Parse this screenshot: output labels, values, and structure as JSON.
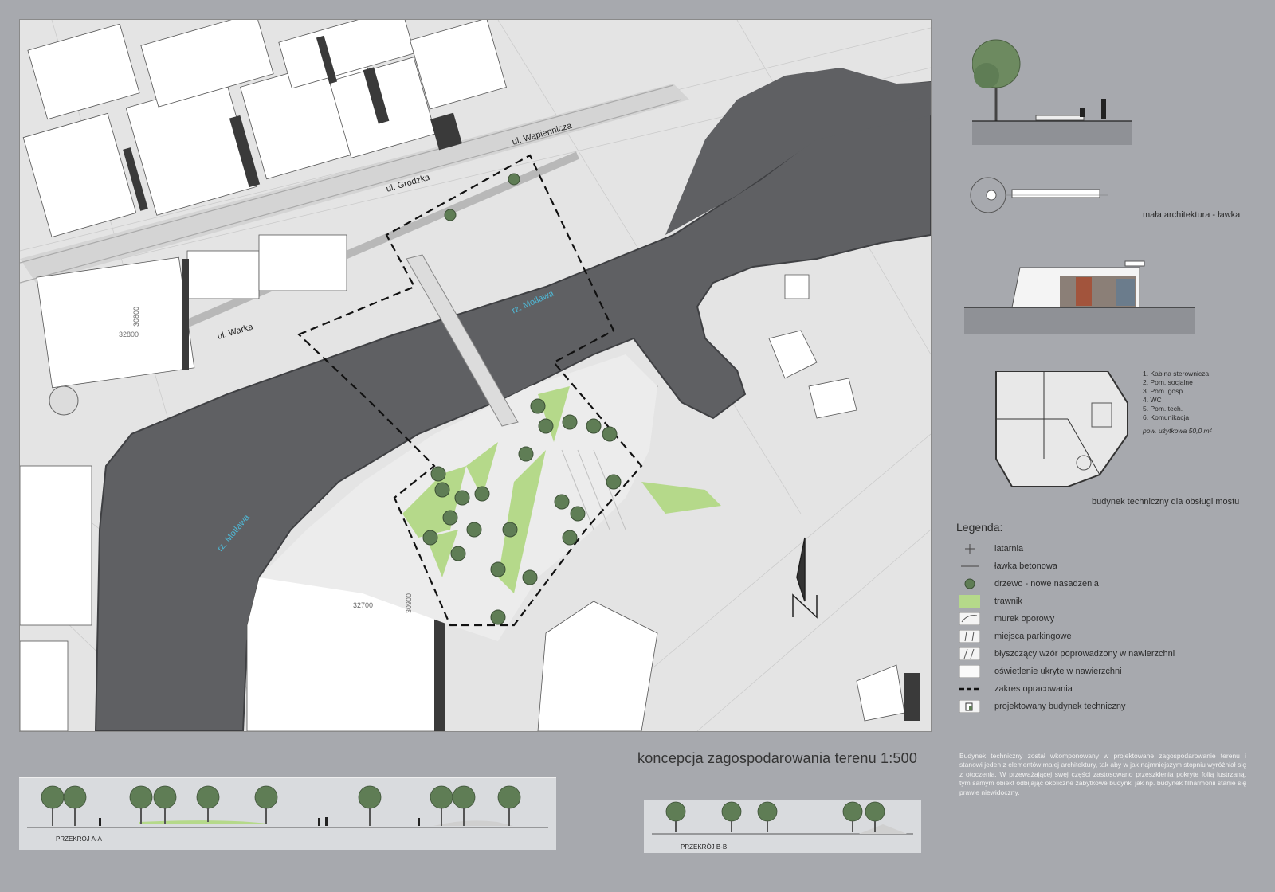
{
  "plan": {
    "title": "koncepcja zagospodarowania terenu 1:500",
    "streets": [
      "ul. Wapiennicza",
      "ul. Grodzka",
      "ul. Warka"
    ],
    "river_labels": [
      "rz. Motława",
      "rz. Motława"
    ],
    "parcel_numbers": [
      "30800",
      "32800",
      "32700",
      "30900"
    ]
  },
  "sections": {
    "aa_label": "PRZEKRÓJ A-A",
    "bb_label": "PRZEKRÓJ B-B"
  },
  "right_panel": {
    "bench_caption": "mała architektura - ławka",
    "building_caption": "budynek techniczny dla obsługi mostu",
    "rooms": [
      "1. Kabina sterownicza",
      "2. Pom. socjalne",
      "3. Pom. gosp.",
      "4. WC",
      "5. Pom. tech.",
      "6. Komunikacja"
    ],
    "area": "pow. użytkowa 50,0 m²"
  },
  "legend": {
    "title": "Legenda:",
    "items": [
      {
        "label": "latarnia",
        "icon": "lamp-icon"
      },
      {
        "label": "ławka betonowa",
        "icon": "bench-icon"
      },
      {
        "label": "drzewo - nowe nasadzenia",
        "icon": "tree-icon"
      },
      {
        "label": "trawnik",
        "icon": "lawn-swatch"
      },
      {
        "label": "murek oporowy",
        "icon": "retaining-wall-swatch"
      },
      {
        "label": "miejsca parkingowe",
        "icon": "parking-swatch"
      },
      {
        "label": "błyszczący wzór poprowadzony w nawierzchni",
        "icon": "shiny-pattern-swatch"
      },
      {
        "label": "oświetlenie ukryte w nawierzchni",
        "icon": "hidden-light-swatch"
      },
      {
        "label": "zakres opracowania",
        "icon": "dashed-line-icon"
      },
      {
        "label": "projektowany budynek techniczny",
        "icon": "building-icon"
      }
    ]
  },
  "description": "Budynek techniczny został wkomponowany w projektowane zagospodarowanie terenu i stanowi jeden z elementów małej architektury, tak aby w jak najmniejszym stopniu wyróżniał się z otoczenia. W przeważającej swej części zastosowano przeszklenia pokryte folią lustrzaną, tym samym obiekt odbijając okoliczne zabytkowe budynki jak np. budynek filharmonii stanie się prawie niewidoczny.",
  "colors": {
    "background": "#a7a9ae",
    "water": "#5f6063",
    "lawn": "#b5d98a",
    "tree": "#5f7d55"
  }
}
